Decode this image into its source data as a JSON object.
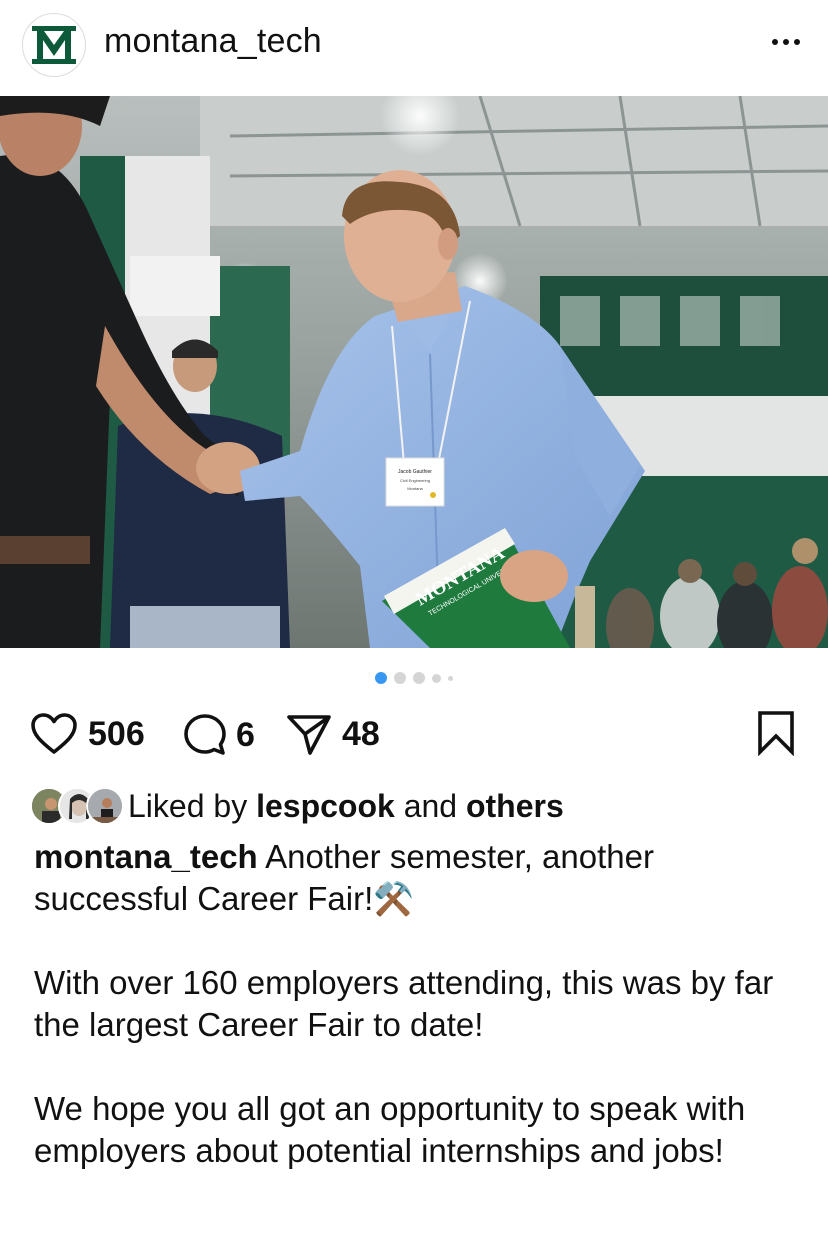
{
  "post": {
    "username": "montana_tech",
    "avatar_logo": "M",
    "more_icon": "more-horizontal-icon"
  },
  "carousel": {
    "count": 5,
    "active_index": 0
  },
  "badge": {
    "name": "Jacob Gauthier",
    "line2": "Civil Engineering",
    "line3": "Montana"
  },
  "folder": {
    "line1": "MONTANA",
    "line2": "TECHNOLOGICAL UNIVERSITY"
  },
  "actions": {
    "likes_count": "506",
    "comments_count": "6",
    "shares_count": "48"
  },
  "liked_by": {
    "prefix": "Liked by",
    "user": "lespcook",
    "middle": "and",
    "others": "others"
  },
  "caption": {
    "user": "montana_tech",
    "line1": "Another semester, another successful Career Fair!⚒️",
    "para2": "With over 160 employers attending, this was by far the largest Career Fair to date!",
    "para3": "We hope you all got an opportunity to speak with employers about potential internships and jobs!"
  },
  "colors": {
    "accent_blue": "#3897f0",
    "brand_green": "#0d5a3a"
  }
}
